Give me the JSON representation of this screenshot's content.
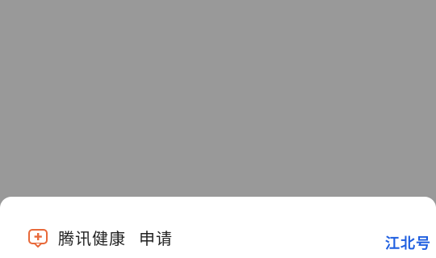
{
  "sheet": {
    "app_name": "腾讯健康",
    "action": "申请",
    "icon": "medical-chat-icon",
    "icon_color": "#e8693a"
  },
  "overlay": {
    "background_color": "#999999"
  },
  "watermark": {
    "text": "江北号",
    "color": "#1f5fe0"
  }
}
